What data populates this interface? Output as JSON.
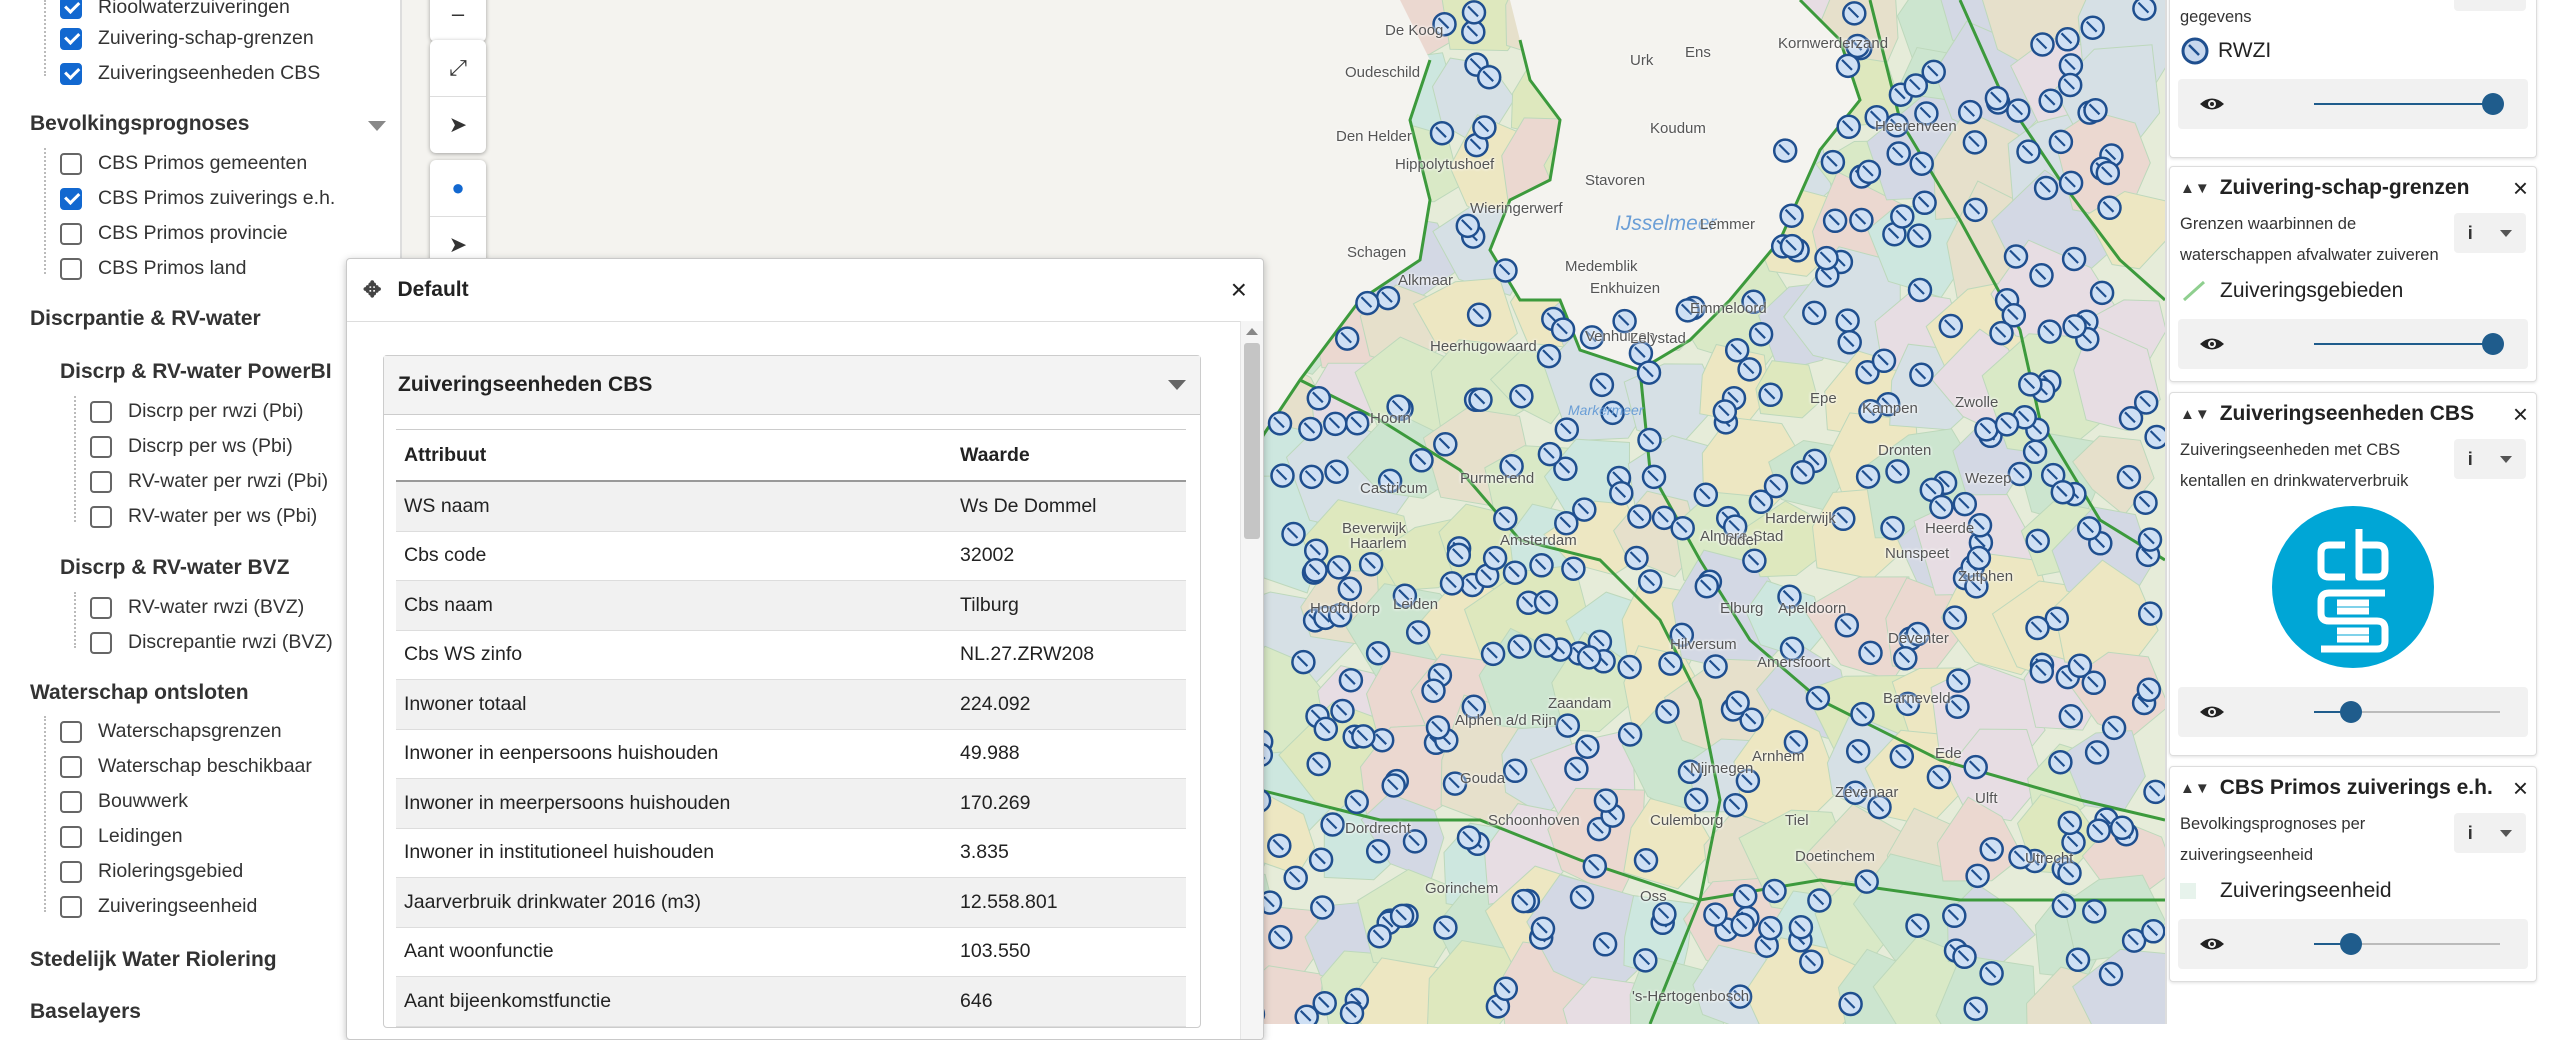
{
  "colors": {
    "accent": "#1268d0",
    "slider": "#1f5c8c",
    "cbs_blue": "#00a6d6"
  },
  "left_panel": {
    "items_top": [
      {
        "label": "Rioolwaterzuiveringen",
        "checked": true
      },
      {
        "label": "Zuivering-schap-grenzen",
        "checked": true
      },
      {
        "label": "Zuiveringseenheden CBS",
        "checked": true
      }
    ],
    "bevolking": {
      "title": "Bevolkingsprognoses",
      "items": [
        {
          "label": "CBS Primos gemeenten",
          "checked": false
        },
        {
          "label": "CBS Primos zuiverings e.h.",
          "checked": true
        },
        {
          "label": "CBS Primos provincie",
          "checked": false
        },
        {
          "label": "CBS Primos land",
          "checked": false
        }
      ]
    },
    "discrepantie": {
      "title": "Discrpantie & RV-water",
      "powerbi": {
        "title": "Discrp & RV-water PowerBI",
        "items": [
          "Discrp per rwzi (Pbi)",
          "Discrp per ws (Pbi)",
          "RV-water per rwzi (Pbi)",
          "RV-water per ws (Pbi)"
        ]
      },
      "bvz": {
        "title": "Discrp & RV-water BVZ",
        "items": [
          "RV-water rwzi (BVZ)",
          "Discrepantie rwzi (BVZ)"
        ]
      }
    },
    "waterschap": {
      "title": "Waterschap ontsloten",
      "items": [
        "Waterschapsgrenzen",
        "Waterschap beschikbaar",
        "Bouwwerk",
        "Leidingen",
        "Rioleringsgebied",
        "Zuiveringseenheid"
      ]
    },
    "stedelijk": "Stedelijk Water Riolering",
    "baselayers": "Baselayers"
  },
  "popup": {
    "title": "Default",
    "layer": "Zuiveringseenheden CBS",
    "headers": [
      "Attribuut",
      "Waarde"
    ],
    "rows": [
      [
        "WS naam",
        "Ws De Dommel"
      ],
      [
        "Cbs code",
        "32002"
      ],
      [
        "Cbs naam",
        "Tilburg"
      ],
      [
        "Cbs WS zinfo",
        "NL.27.ZRW208"
      ],
      [
        "Inwoner totaal",
        "224.092"
      ],
      [
        "Inwoner in eenpersoons huishouden",
        "49.988"
      ],
      [
        "Inwoner in meerpersoons huishouden",
        "170.269"
      ],
      [
        "Inwoner in institutioneel huishouden",
        "3.835"
      ],
      [
        "Jaarverbruik drinkwater 2016 (m3)",
        "12.558.801"
      ],
      [
        "Aant woonfunctie",
        "103.550"
      ],
      [
        "Aant bijeenkomstfunctie",
        "646"
      ]
    ]
  },
  "map_labels": {
    "ijsselmeer": "IJsselmeer",
    "markermeer": "Markermeer",
    "places": [
      "De Koog",
      "Oudeschild",
      "Den Helder",
      "Hippolytushoef",
      "Wieringerwerf",
      "Medemblik",
      "Schagen",
      "Enkhuizen",
      "Venhuizen",
      "Lelystad",
      "Stavoren",
      "Koudum",
      "Lemmer",
      "Emmeloord",
      "Urk",
      "Ens",
      "Kornwerderzand",
      "Heerenveen",
      "Kampen",
      "Dronten",
      "Zwolle",
      "Wezep",
      "Heerde",
      "Nunspeet",
      "Harderwijk",
      "Apeldoorn",
      "Deventer",
      "Zutphen",
      "Almere-Stad",
      "Amsterdam",
      "Haarlem",
      "Hilversum",
      "Amersfoort",
      "Barneveld",
      "Ede",
      "Arnhem",
      "Nijmegen",
      "Zevenaar",
      "Ulft",
      "Utrecht",
      "Zaandam",
      "Purmerend",
      "Hoorn",
      "Alkmaar",
      "Heerhugowaard",
      "Castricum",
      "Beverwijk",
      "Hoofddorp",
      "Leiden",
      "Alphen a/d Rijn",
      "Gouda",
      "Dordrecht",
      "Gorinchem",
      "Oss",
      "'s-Hertogenbosch",
      "Uddel",
      "Elburg",
      "Schoonhoven",
      "Culemborg",
      "Tiel",
      "Epe",
      "Doetinchem"
    ]
  },
  "legend": {
    "rwzi": {
      "desc": "gegevens",
      "symbol": "RWZI",
      "opacity": 0.96
    },
    "zuivering": {
      "title": "Zuivering-schap-grenzen",
      "desc": "Grenzen waarbinnen de waterschappen afvalwater zuiveren",
      "symbol": "Zuiveringsgebieden",
      "info": "i",
      "opacity": 0.96
    },
    "cbs": {
      "title": "Zuiveringseenheden CBS",
      "desc": "Zuiveringseenheden met CBS kentallen en drinkwaterverbruik",
      "info": "i",
      "opacity": 0.2
    },
    "primos": {
      "title": "CBS Primos zuiverings e.h.",
      "desc": "Bevolkingsprognoses per zuiveringseenheid",
      "symbol": "Zuiveringseenheid",
      "info": "i",
      "opacity": 0.2
    }
  }
}
